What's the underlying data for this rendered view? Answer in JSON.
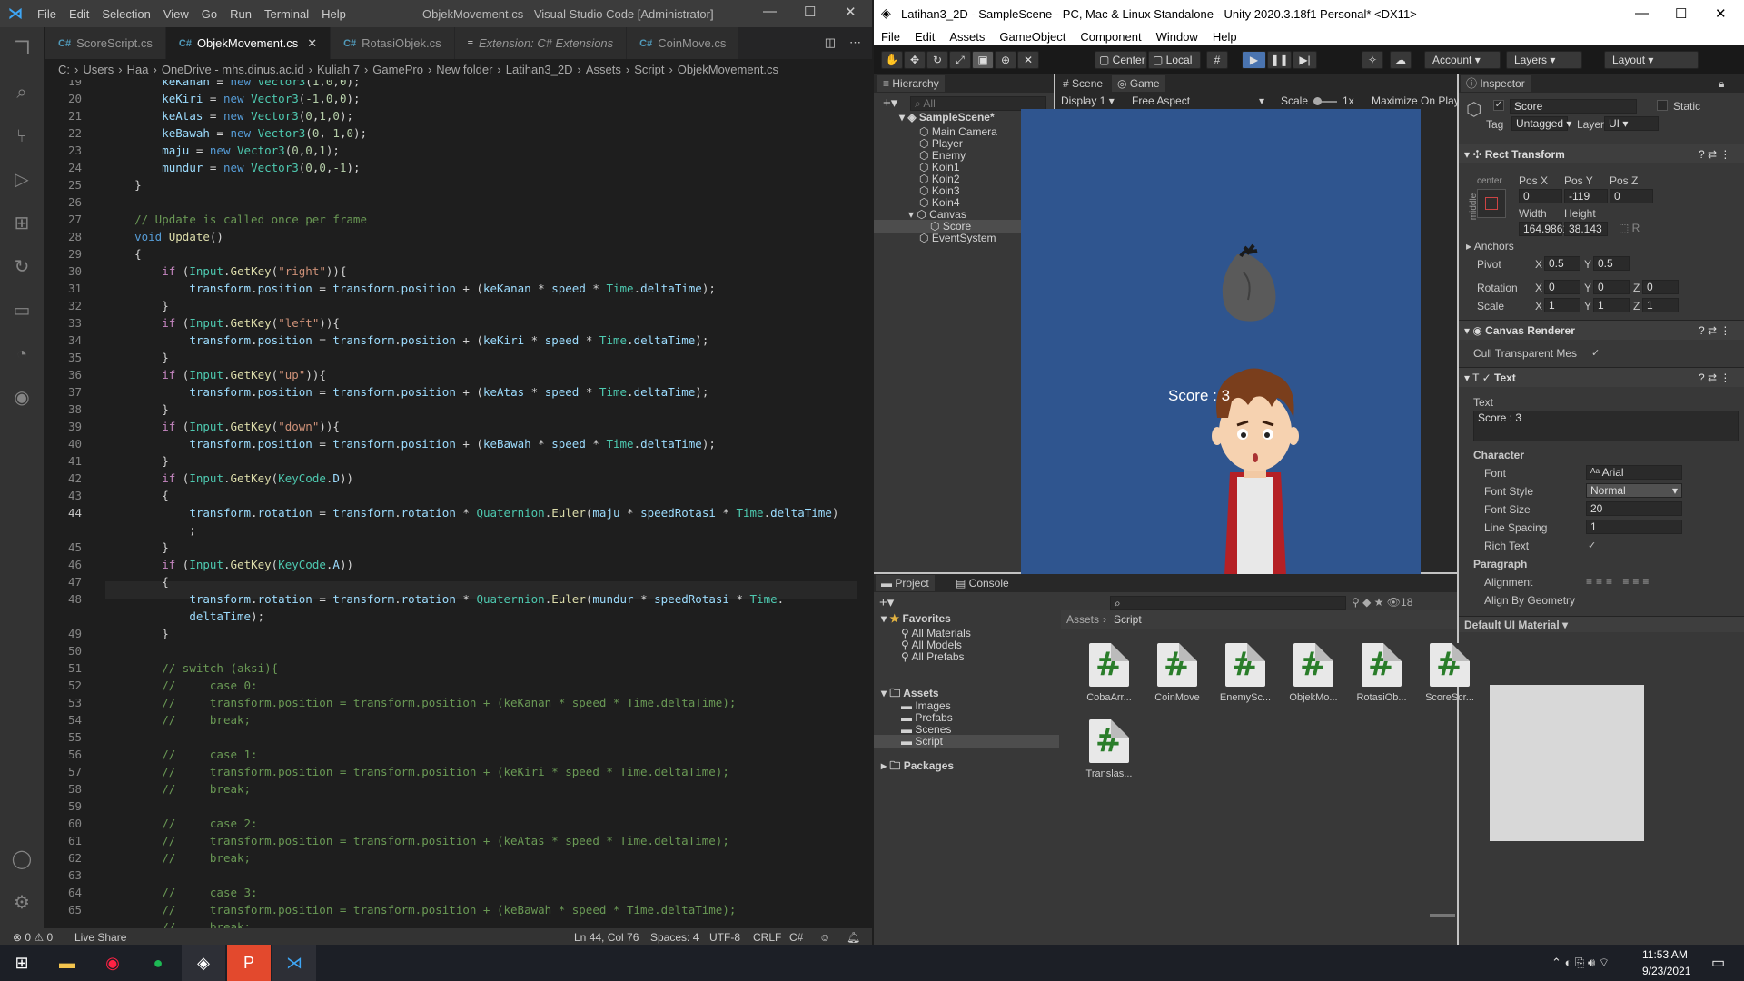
{
  "vscode": {
    "menu": [
      "File",
      "Edit",
      "Selection",
      "View",
      "Go",
      "Run",
      "Terminal",
      "Help"
    ],
    "title": "ObjekMovement.cs - Visual Studio Code [Administrator]",
    "tabs": [
      {
        "label": "ScoreScript.cs",
        "icon": "C#",
        "active": false
      },
      {
        "label": "ObjekMovement.cs",
        "icon": "C#",
        "active": true
      },
      {
        "label": "RotasiObjek.cs",
        "icon": "C#",
        "active": false
      },
      {
        "label": "Extension: C# Extensions",
        "icon": "≡",
        "active": false
      },
      {
        "label": "CoinMove.cs",
        "icon": "C#",
        "active": false
      }
    ],
    "breadcrumb": [
      "C:",
      "Users",
      "Haa",
      "OneDrive - mhs.dinus.ac.id",
      "Kuliah 7",
      "GamePro",
      "New folder",
      "Latihan3_2D",
      "Assets",
      "Script",
      "ObjekMovement.cs"
    ],
    "line_numbers": [
      "19",
      "20",
      "21",
      "22",
      "23",
      "24",
      "25",
      "26",
      "27",
      "28",
      "29",
      "30",
      "31",
      "32",
      "33",
      "34",
      "35",
      "36",
      "37",
      "38",
      "39",
      "40",
      "41",
      "42",
      "43",
      "44",
      "",
      "45",
      "46",
      "47",
      "48",
      "",
      "49",
      "50",
      "51",
      "52",
      "53",
      "54",
      "55",
      "56",
      "57",
      "58",
      "59",
      "60",
      "61",
      "62",
      "63",
      "64",
      "65"
    ],
    "status": {
      "problems": "⊗ 0 ⚠ 0",
      "liveshare": "Live Share",
      "position": "Ln 44, Col 76",
      "spaces": "Spaces: 4",
      "encoding": "UTF-8",
      "eol": "CRLF",
      "lang": "C#"
    }
  },
  "unity": {
    "title": "Latihan3_2D - SampleScene - PC, Mac & Linux Standalone - Unity 2020.3.18f1 Personal* <DX11>",
    "menu": [
      "File",
      "Edit",
      "Assets",
      "GameObject",
      "Component",
      "Window",
      "Help"
    ],
    "toolbar": {
      "center": "Center",
      "local": "Local",
      "account": "Account",
      "layers": "Layers",
      "layout": "Layout"
    },
    "hierarchy": {
      "tab": "Hierarchy",
      "search": "All",
      "scene": "SampleScene*",
      "items": [
        "Main Camera",
        "Player",
        "Enemy",
        "Koin1",
        "Koin2",
        "Koin3",
        "Koin4",
        "Canvas",
        "Score",
        "EventSystem"
      ]
    },
    "game": {
      "tab_scene": "Scene",
      "tab_game": "Game",
      "display": "Display 1",
      "aspect": "Free Aspect",
      "scale_label": "Scale",
      "scale_value": "1x",
      "maximize": "Maximize On Play",
      "score_text": "Score : 3"
    },
    "inspector": {
      "tab": "Inspector",
      "object_name": "Score",
      "static": "Static",
      "tag_label": "Tag",
      "tag": "Untagged",
      "layer_label": "Layer",
      "layer": "UI",
      "rect_transform": "Rect Transform",
      "center": "center",
      "middle": "middle",
      "posx_label": "Pos X",
      "posy_label": "Pos Y",
      "posz_label": "Pos Z",
      "posx": "0",
      "posy": "-119",
      "posz": "0",
      "width_label": "Width",
      "height_label": "Height",
      "width": "164.9861",
      "height": "38.143",
      "anchors": "Anchors",
      "pivot": "Pivot",
      "pivot_x": "0.5",
      "pivot_y": "0.5",
      "rotation": "Rotation",
      "rot_x": "0",
      "rot_y": "0",
      "rot_z": "0",
      "scale": "Scale",
      "sc_x": "1",
      "sc_y": "1",
      "sc_z": "1",
      "canvas_renderer": "Canvas Renderer",
      "cull": "Cull Transparent Mes",
      "text_comp": "Text",
      "text_label": "Text",
      "text_value": "Score : 3",
      "character": "Character",
      "font_label": "Font",
      "font": "Arial",
      "font_style_label": "Font Style",
      "font_style": "Normal",
      "font_size_label": "Font Size",
      "font_size": "20",
      "line_spacing_label": "Line Spacing",
      "line_spacing": "1",
      "rich_text_label": "Rich Text",
      "paragraph": "Paragraph",
      "alignment_label": "Alignment",
      "align_geom_label": "Align By Geometry",
      "material": "Default UI Material"
    },
    "project": {
      "tab_project": "Project",
      "tab_console": "Console",
      "count": "18",
      "favorites": "Favorites",
      "fav_items": [
        "All Materials",
        "All Models",
        "All Prefabs"
      ],
      "assets": "Assets",
      "asset_folders": [
        "Images",
        "Prefabs",
        "Scenes",
        "Script"
      ],
      "packages": "Packages",
      "path_assets": "Assets",
      "path_script": "Script",
      "files": [
        "CobaArr...",
        "CoinMove",
        "EnemySc...",
        "ObjekMo...",
        "RotasiOb...",
        "ScoreScr...",
        "Translas..."
      ]
    }
  },
  "taskbar": {
    "time": "11:53 AM",
    "date": "9/23/2021"
  }
}
